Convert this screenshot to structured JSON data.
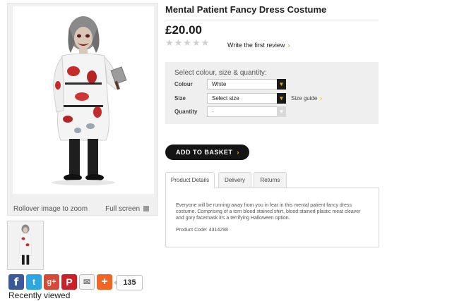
{
  "product": {
    "title": "Mental Patient Fancy Dress Costume",
    "price": "£20.00",
    "rating_stars_filled": 0,
    "rating_stars_total": 5,
    "stars_display": "★★★★★",
    "write_review_label": "Write the first review"
  },
  "image_panel": {
    "zoom_hint": "Rollover image to zoom",
    "fullscreen_label": "Full screen"
  },
  "options": {
    "heading": "Select colour, size & quantity:",
    "colour_label": "Colour",
    "colour_value": "White",
    "size_label": "Size",
    "size_value": "Select size",
    "size_guide_label": "Size guide",
    "quantity_label": "Quantity",
    "quantity_value": "-"
  },
  "basket_label": "ADD TO BASKET",
  "tabs": [
    {
      "label": "Product Details",
      "active": true
    },
    {
      "label": "Delivery",
      "active": false
    },
    {
      "label": "Returns",
      "active": false
    }
  ],
  "details": {
    "description": "Everyone will be running away from you in fear in this mental patient fancy dress costume. Comprising of a torn blood stained shirt, blood stained plastic meat cleaver and gory facemask it's a terrifying Halloween option.",
    "product_code": "Product Code: 4314298"
  },
  "share": {
    "count": "135",
    "icons": [
      "facebook-icon",
      "twitter-icon",
      "google-plus-icon",
      "pinterest-icon",
      "email-icon",
      "plus-icon"
    ]
  },
  "recently_viewed_label": "Recently viewed",
  "colors": {
    "accent": "#f2a900",
    "button_dark": "#141414",
    "facebook": "#3b5998",
    "twitter": "#2ea7e0",
    "google_plus": "#d84a38",
    "pinterest": "#cb2027",
    "share_plus": "#f26522"
  }
}
